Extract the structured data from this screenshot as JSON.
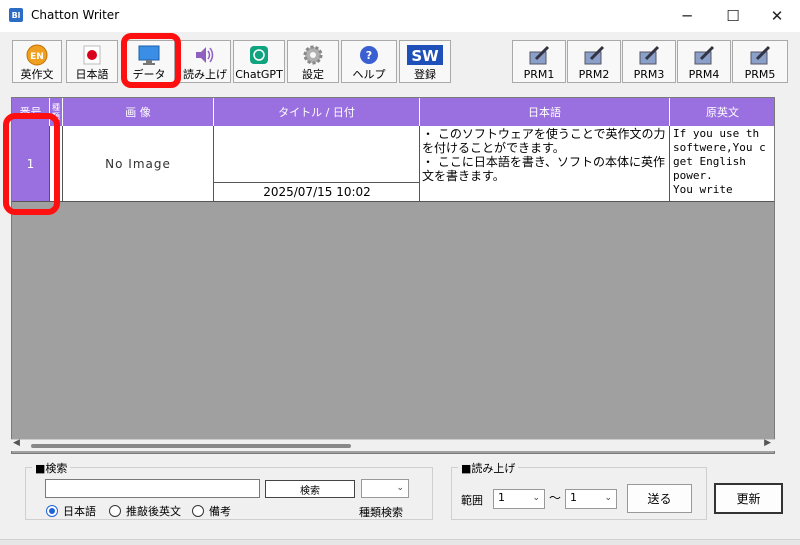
{
  "window": {
    "title": "Chatton Writer",
    "app_icon_text": "Bl",
    "minimize_glyph": "─",
    "maximize_glyph": "☐",
    "close_glyph": "✕"
  },
  "toolbar": {
    "items": [
      {
        "label": "英作文",
        "icon": "en-circle-icon"
      },
      {
        "label": "日本語",
        "icon": "japan-flag-icon"
      },
      {
        "label": "データ",
        "icon": "monitor-icon"
      },
      {
        "label": "読み上げ",
        "icon": "speaker-icon"
      },
      {
        "label": "ChatGPT",
        "icon": "chatgpt-icon"
      },
      {
        "label": "設定",
        "icon": "gear-icon"
      },
      {
        "label": "ヘルプ",
        "icon": "help-icon"
      },
      {
        "label": "登録",
        "icon": "sw-icon",
        "badge": "SW"
      }
    ],
    "prm": [
      {
        "label": "PRM1"
      },
      {
        "label": "PRM2"
      },
      {
        "label": "PRM3"
      },
      {
        "label": "PRM4"
      },
      {
        "label": "PRM5"
      }
    ]
  },
  "grid": {
    "headers": {
      "num": "番号",
      "type": "種類",
      "image": "画 像",
      "title_date": "タイトル / 日付",
      "japanese": "日本語",
      "original_english": "原英文"
    },
    "rows": [
      {
        "num": "1",
        "image": "No Image",
        "title": "",
        "date": "2025/07/15 10:02",
        "japanese": "・ このソフトウェアを使うことで英作文の力を付けることができます。\n・ ここに日本語を書き、ソフトの本体に英作文を書きます。",
        "original_english": "If you use th\nsoftwere,You c\nget English\npower.\nYou write"
      }
    ]
  },
  "search": {
    "group_title": "■検索",
    "input_value": "",
    "button_label": "検索",
    "type_select_value": "",
    "type_search_label": "種類検索",
    "radios": [
      {
        "label": "日本語",
        "selected": true
      },
      {
        "label": "推敲後英文",
        "selected": false
      },
      {
        "label": "備考",
        "selected": false
      }
    ]
  },
  "read_aloud": {
    "group_title": "■読み上げ",
    "range_label": "範囲",
    "from_value": "1",
    "tilde": "～",
    "to_value": "1",
    "send_label": "送る"
  },
  "update_label": "更新",
  "colors": {
    "header_purple": "#9a6fe0",
    "highlight_red": "#ff1010",
    "grid_gray": "#a0a0a0"
  }
}
